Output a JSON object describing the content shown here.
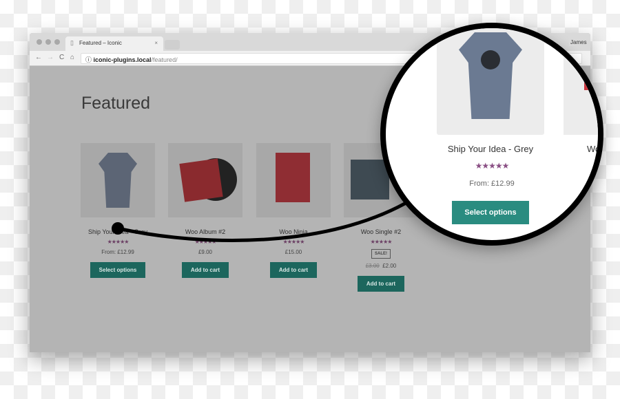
{
  "browser": {
    "tab_title": "Featured – Iconic",
    "tab_close": "×",
    "user": "James",
    "url_host": "iconic-plugins.local",
    "url_path": "/featured/",
    "back": "←",
    "forward": "→",
    "reload": "C",
    "home": "⌂",
    "info": "ⓘ",
    "menu": "⋮"
  },
  "page": {
    "title": "Featured"
  },
  "products": [
    {
      "name": "Ship Your Idea - Grey",
      "stars": "★★★★★",
      "rating": 4.5,
      "price": "From: £12.99",
      "button": "Select options"
    },
    {
      "name": "Woo Album #2",
      "stars": "★★★★★",
      "rating": 4.5,
      "price": "£9.00",
      "button": "Add to cart"
    },
    {
      "name": "Woo Ninja",
      "stars": "★★★★★",
      "rating": 4,
      "price": "£15.00",
      "button": "Add to cart"
    },
    {
      "name": "Woo Single #2",
      "stars": "★★★★★",
      "rating": 4.5,
      "badge": "SALE!",
      "old_price": "£3.00",
      "price": "£2.00",
      "button": "Add to cart"
    }
  ],
  "magnifier": {
    "name": "Ship Your Idea - Grey",
    "stars": "★★★★★",
    "rating": 4.5,
    "price": "From: £12.99",
    "button": "Select options",
    "next_name": "Wo"
  },
  "colors": {
    "button": "#2a8c80",
    "star": "#8a4f84"
  }
}
